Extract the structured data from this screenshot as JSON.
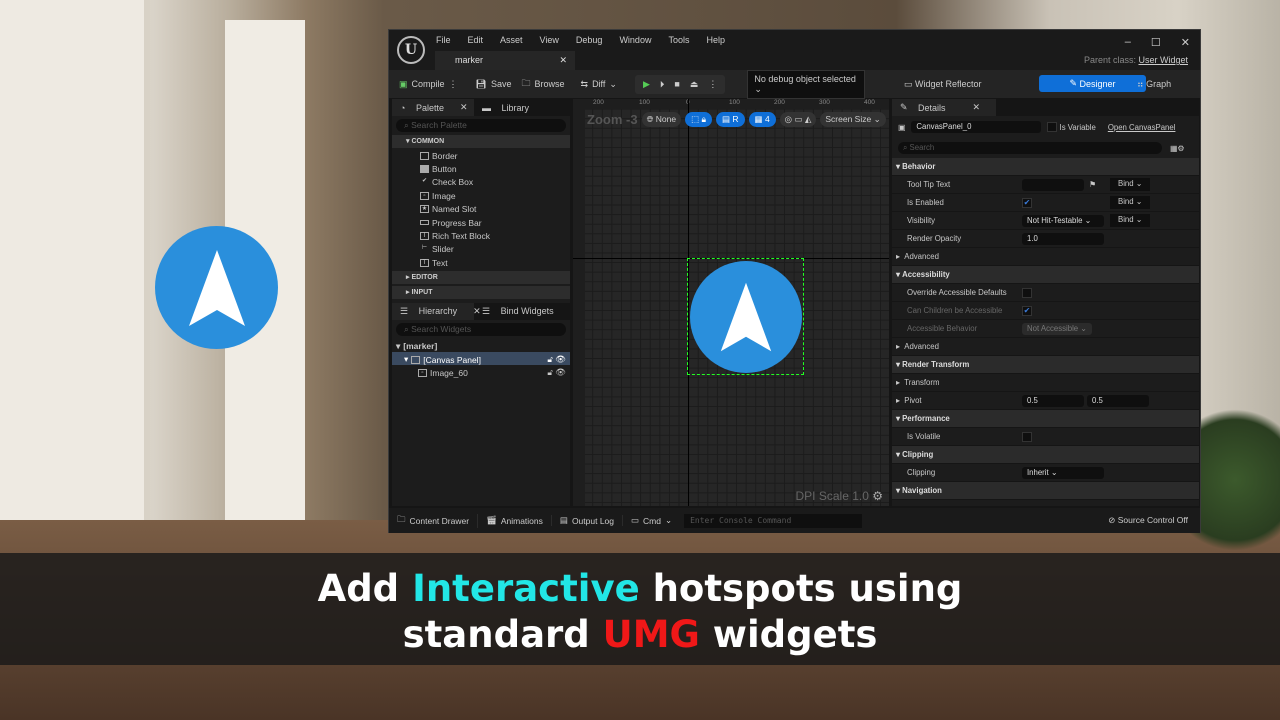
{
  "window": {
    "menu": [
      "File",
      "Edit",
      "Asset",
      "View",
      "Debug",
      "Window",
      "Tools",
      "Help"
    ],
    "tab": "marker",
    "parent_label": "Parent class:",
    "parent_value": "User Widget"
  },
  "toolbar": {
    "compile": "Compile",
    "save": "Save",
    "browse": "Browse",
    "diff": "Diff",
    "debug": "No debug object selected",
    "reflector": "Widget Reflector",
    "designer": "Designer",
    "graph": "Graph"
  },
  "palette": {
    "tab": "Palette",
    "library": "Library",
    "search": "Search Palette",
    "common": "COMMON",
    "items": [
      "Border",
      "Button",
      "Check Box",
      "Image",
      "Named Slot",
      "Progress Bar",
      "Rich Text Block",
      "Slider",
      "Text"
    ],
    "editor": "EDITOR",
    "input": "INPUT"
  },
  "hierarchy": {
    "tab": "Hierarchy",
    "bind": "Bind Widgets",
    "search": "Search Widgets",
    "root": "[marker]",
    "canvas": "[Canvas Panel]",
    "image": "Image_60"
  },
  "canvas": {
    "zoom": "Zoom -3",
    "none": "None",
    "r": "R",
    "grid": "4",
    "screen": "Screen Size",
    "dpi": "DPI Scale 1.0",
    "ruler": [
      "200",
      "100",
      "0",
      "100",
      "200",
      "300",
      "400"
    ]
  },
  "details": {
    "tab": "Details",
    "name": "CanvasPanel_0",
    "is_variable": "Is Variable",
    "open": "Open CanvasPanel",
    "search": "Search",
    "behavior": "Behavior",
    "tooltip": "Tool Tip Text",
    "bind": "Bind",
    "enabled": "Is Enabled",
    "visibility": "Visibility",
    "visibility_val": "Not Hit-Testable",
    "opacity": "Render Opacity",
    "opacity_val": "1.0",
    "advanced": "Advanced",
    "accessibility": "Accessibility",
    "override": "Override Accessible Defaults",
    "children": "Can Children be Accessible",
    "acc_behavior": "Accessible Behavior",
    "acc_val": "Not Accessible",
    "render_transform": "Render Transform",
    "transform": "Transform",
    "pivot": "Pivot",
    "pivot_x": "0.5",
    "pivot_y": "0.5",
    "performance": "Performance",
    "volatile": "Is Volatile",
    "clipping_hdr": "Clipping",
    "clipping": "Clipping",
    "clipping_val": "Inherit",
    "navigation": "Navigation"
  },
  "bottom": {
    "content": "Content Drawer",
    "animations": "Animations",
    "output": "Output Log",
    "cmd": "Cmd",
    "console": "Enter Console Command",
    "scm": "Source Control Off"
  },
  "caption": {
    "l1a": "Add ",
    "l1b": "Interactive",
    "l1c": " hotspots using",
    "l2a": "standard ",
    "l2b": "UMG",
    "l2c": " widgets"
  }
}
